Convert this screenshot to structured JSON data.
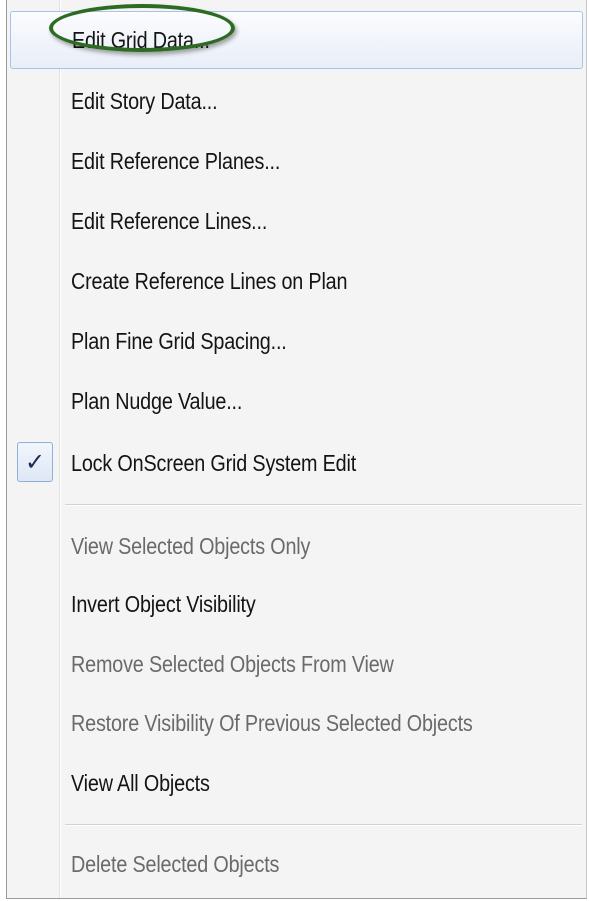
{
  "menu": {
    "items": [
      {
        "label": "Edit Grid Data...",
        "state": "hover"
      },
      {
        "label": "Edit Story Data..."
      },
      {
        "label": "Edit Reference Planes..."
      },
      {
        "label": "Edit Reference Lines..."
      },
      {
        "label": "Create Reference Lines on Plan"
      },
      {
        "label": "Plan Fine Grid Spacing..."
      },
      {
        "label": "Plan Nudge Value..."
      },
      {
        "label": "Lock OnScreen Grid System Edit",
        "checked": true,
        "check_glyph": "✓"
      },
      {
        "label": "View Selected Objects Only",
        "disabled": true
      },
      {
        "label": "Invert Object Visibility"
      },
      {
        "label": "Remove Selected Objects From View",
        "disabled": true
      },
      {
        "label": "Restore Visibility Of Previous Selected Objects",
        "disabled": true
      },
      {
        "label": "View All Objects"
      },
      {
        "label": "Delete Selected Objects",
        "disabled": true
      }
    ]
  },
  "colors": {
    "menu_background": "#f4f4f4",
    "hover_border": "#a9c3e6",
    "highlight_oval": "#2d6a22",
    "enabled_text": "#141414",
    "disabled_text": "#6a6a6a"
  }
}
